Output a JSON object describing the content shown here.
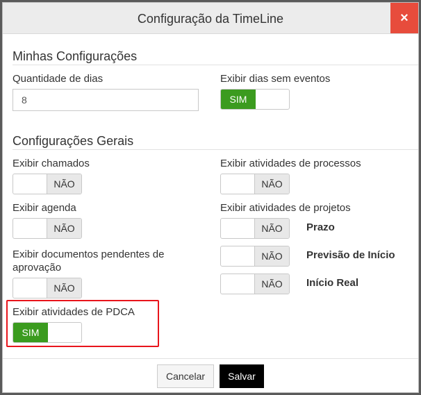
{
  "dialog": {
    "title": "Configuração da TimeLine",
    "close_icon": "×"
  },
  "my_settings": {
    "title": "Minhas Configurações",
    "days_label": "Quantidade de dias",
    "days_value": "8",
    "show_empty_days_label": "Exibir dias sem eventos",
    "show_empty_days_value": "SIM"
  },
  "general_settings": {
    "title": "Configurações Gerais",
    "show_calls_label": "Exibir chamados",
    "show_calls_value": "NÃO",
    "show_agenda_label": "Exibir agenda",
    "show_agenda_value": "NÃO",
    "show_pending_docs_label": "Exibir documentos pendentes de aprovação",
    "show_pending_docs_value": "NÃO",
    "show_pdca_label": "Exibir atividades de PDCA",
    "show_pdca_value": "SIM",
    "show_process_label": "Exibir atividades de processos",
    "show_process_value": "NÃO",
    "show_projects_label": "Exibir atividades de projetos",
    "projects": [
      {
        "value": "NÃO",
        "label": "Prazo"
      },
      {
        "value": "NÃO",
        "label": "Previsão de Início"
      },
      {
        "value": "NÃO",
        "label": "Início Real"
      }
    ]
  },
  "footer": {
    "cancel_label": "Cancelar",
    "save_label": "Salvar"
  },
  "colors": {
    "toggle_on": "#3b9b1f",
    "close_button": "#e74c3c",
    "highlight": "#e8141b"
  }
}
